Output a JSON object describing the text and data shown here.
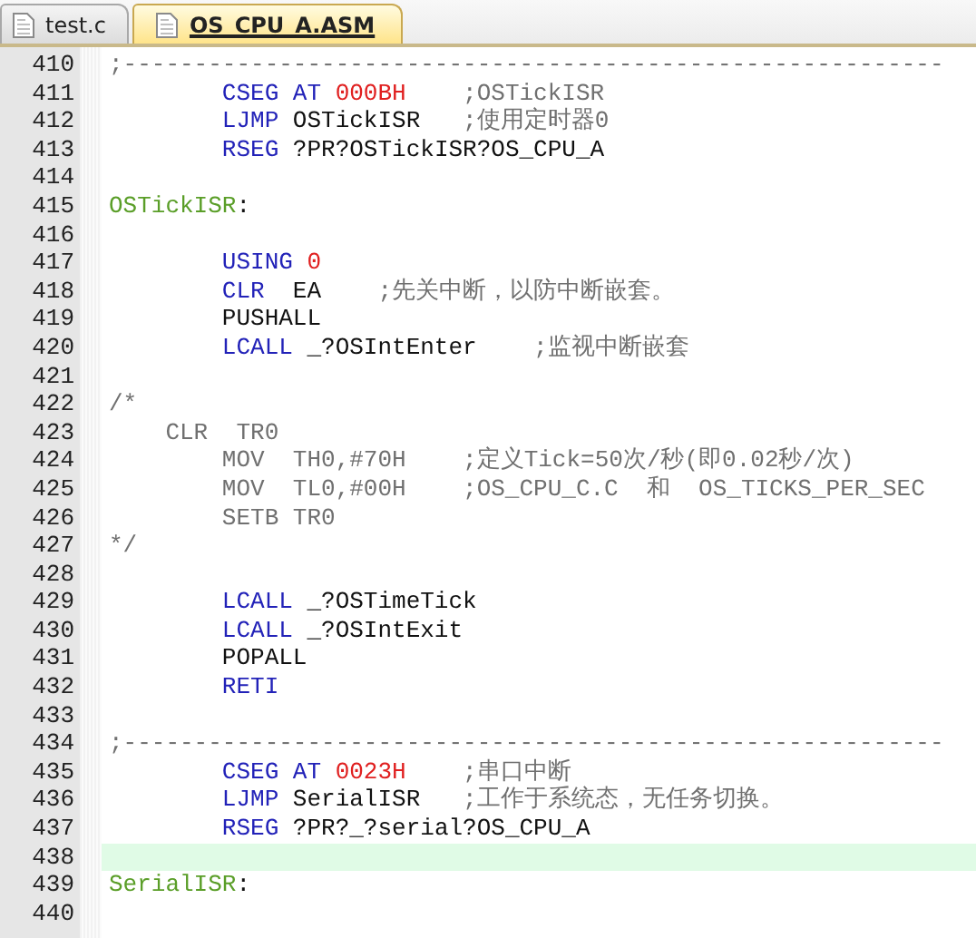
{
  "tabs": [
    {
      "label": "test.c",
      "selected": false
    },
    {
      "label": "OS_CPU_A.ASM",
      "selected": true
    }
  ],
  "lines": [
    {
      "number": "410",
      "current": false,
      "tokens": [
        {
          "kind": "comment",
          "text": ";----------------------------------------------------------"
        }
      ]
    },
    {
      "number": "411",
      "current": false,
      "tokens": [
        {
          "kind": "keyword",
          "text": "        CSEG AT "
        },
        {
          "kind": "number",
          "text": "000BH    "
        },
        {
          "kind": "comment",
          "text": ";OSTickISR"
        }
      ]
    },
    {
      "number": "412",
      "current": false,
      "tokens": [
        {
          "kind": "keyword",
          "text": "        LJMP"
        },
        {
          "kind": "plain",
          "text": " OSTickISR   "
        },
        {
          "kind": "comment",
          "text": ";使用定时器0"
        }
      ]
    },
    {
      "number": "413",
      "current": false,
      "tokens": [
        {
          "kind": "keyword",
          "text": "        RSEG"
        },
        {
          "kind": "plain",
          "text": " ?PR?OSTickISR?OS_CPU_A"
        }
      ]
    },
    {
      "number": "414",
      "current": false
    },
    {
      "number": "415",
      "current": false,
      "tokens": [
        {
          "kind": "label",
          "text": "OSTickISR"
        },
        {
          "kind": "plain",
          "text": ":"
        }
      ]
    },
    {
      "number": "416",
      "current": false
    },
    {
      "number": "417",
      "current": false,
      "tokens": [
        {
          "kind": "keyword",
          "text": "        USING "
        },
        {
          "kind": "number",
          "text": "0"
        }
      ]
    },
    {
      "number": "418",
      "current": false,
      "tokens": [
        {
          "kind": "keyword",
          "text": "        CLR"
        },
        {
          "kind": "plain",
          "text": "  EA    "
        },
        {
          "kind": "comment",
          "text": ";先关中断，以防中断嵌套。"
        }
      ]
    },
    {
      "number": "419",
      "current": false,
      "tokens": [
        {
          "kind": "plain",
          "text": "        PUSHALL"
        }
      ]
    },
    {
      "number": "420",
      "current": false,
      "tokens": [
        {
          "kind": "keyword",
          "text": "        LCALL"
        },
        {
          "kind": "plain",
          "text": " _?OSIntEnter    "
        },
        {
          "kind": "comment",
          "text": ";监视中断嵌套"
        }
      ]
    },
    {
      "number": "421",
      "current": false
    },
    {
      "number": "422",
      "current": false,
      "tokens": [
        {
          "kind": "comment",
          "text": "/*"
        }
      ]
    },
    {
      "number": "423",
      "current": false,
      "tokens": [
        {
          "kind": "comment",
          "text": "    CLR  TR0"
        }
      ]
    },
    {
      "number": "424",
      "current": false,
      "tokens": [
        {
          "kind": "comment",
          "text": "        MOV  TH0,#70H    ;定义Tick=50次/秒(即0.02秒/次)"
        }
      ]
    },
    {
      "number": "425",
      "current": false,
      "tokens": [
        {
          "kind": "comment",
          "text": "        MOV  TL0,#00H    ;OS_CPU_C.C  和  OS_TICKS_PER_SEC"
        }
      ]
    },
    {
      "number": "426",
      "current": false,
      "tokens": [
        {
          "kind": "comment",
          "text": "        SETB TR0"
        }
      ]
    },
    {
      "number": "427",
      "current": false,
      "tokens": [
        {
          "kind": "comment",
          "text": "*/"
        }
      ]
    },
    {
      "number": "428",
      "current": false
    },
    {
      "number": "429",
      "current": false,
      "tokens": [
        {
          "kind": "keyword",
          "text": "        LCALL"
        },
        {
          "kind": "plain",
          "text": " _?OSTimeTick"
        }
      ]
    },
    {
      "number": "430",
      "current": false,
      "tokens": [
        {
          "kind": "keyword",
          "text": "        LCALL"
        },
        {
          "kind": "plain",
          "text": " _?OSIntExit"
        }
      ]
    },
    {
      "number": "431",
      "current": false,
      "tokens": [
        {
          "kind": "plain",
          "text": "        POPALL"
        }
      ]
    },
    {
      "number": "432",
      "current": false,
      "tokens": [
        {
          "kind": "keyword",
          "text": "        RETI"
        }
      ]
    },
    {
      "number": "433",
      "current": false
    },
    {
      "number": "434",
      "current": false,
      "tokens": [
        {
          "kind": "comment",
          "text": ";----------------------------------------------------------"
        }
      ]
    },
    {
      "number": "435",
      "current": false,
      "tokens": [
        {
          "kind": "keyword",
          "text": "        CSEG AT "
        },
        {
          "kind": "number",
          "text": "0023H    "
        },
        {
          "kind": "comment",
          "text": ";串口中断"
        }
      ]
    },
    {
      "number": "436",
      "current": false,
      "tokens": [
        {
          "kind": "keyword",
          "text": "        LJMP"
        },
        {
          "kind": "plain",
          "text": " SerialISR   "
        },
        {
          "kind": "comment",
          "text": ";工作于系统态，无任务切换。"
        }
      ]
    },
    {
      "number": "437",
      "current": false,
      "tokens": [
        {
          "kind": "keyword",
          "text": "        RSEG"
        },
        {
          "kind": "plain",
          "text": " ?PR?_?serial?OS_CPU_A"
        }
      ]
    },
    {
      "number": "438",
      "current": true
    },
    {
      "number": "439",
      "current": false,
      "tokens": [
        {
          "kind": "label",
          "text": "SerialISR"
        },
        {
          "kind": "plain",
          "text": ":"
        }
      ]
    },
    {
      "number": "440",
      "current": false
    }
  ]
}
